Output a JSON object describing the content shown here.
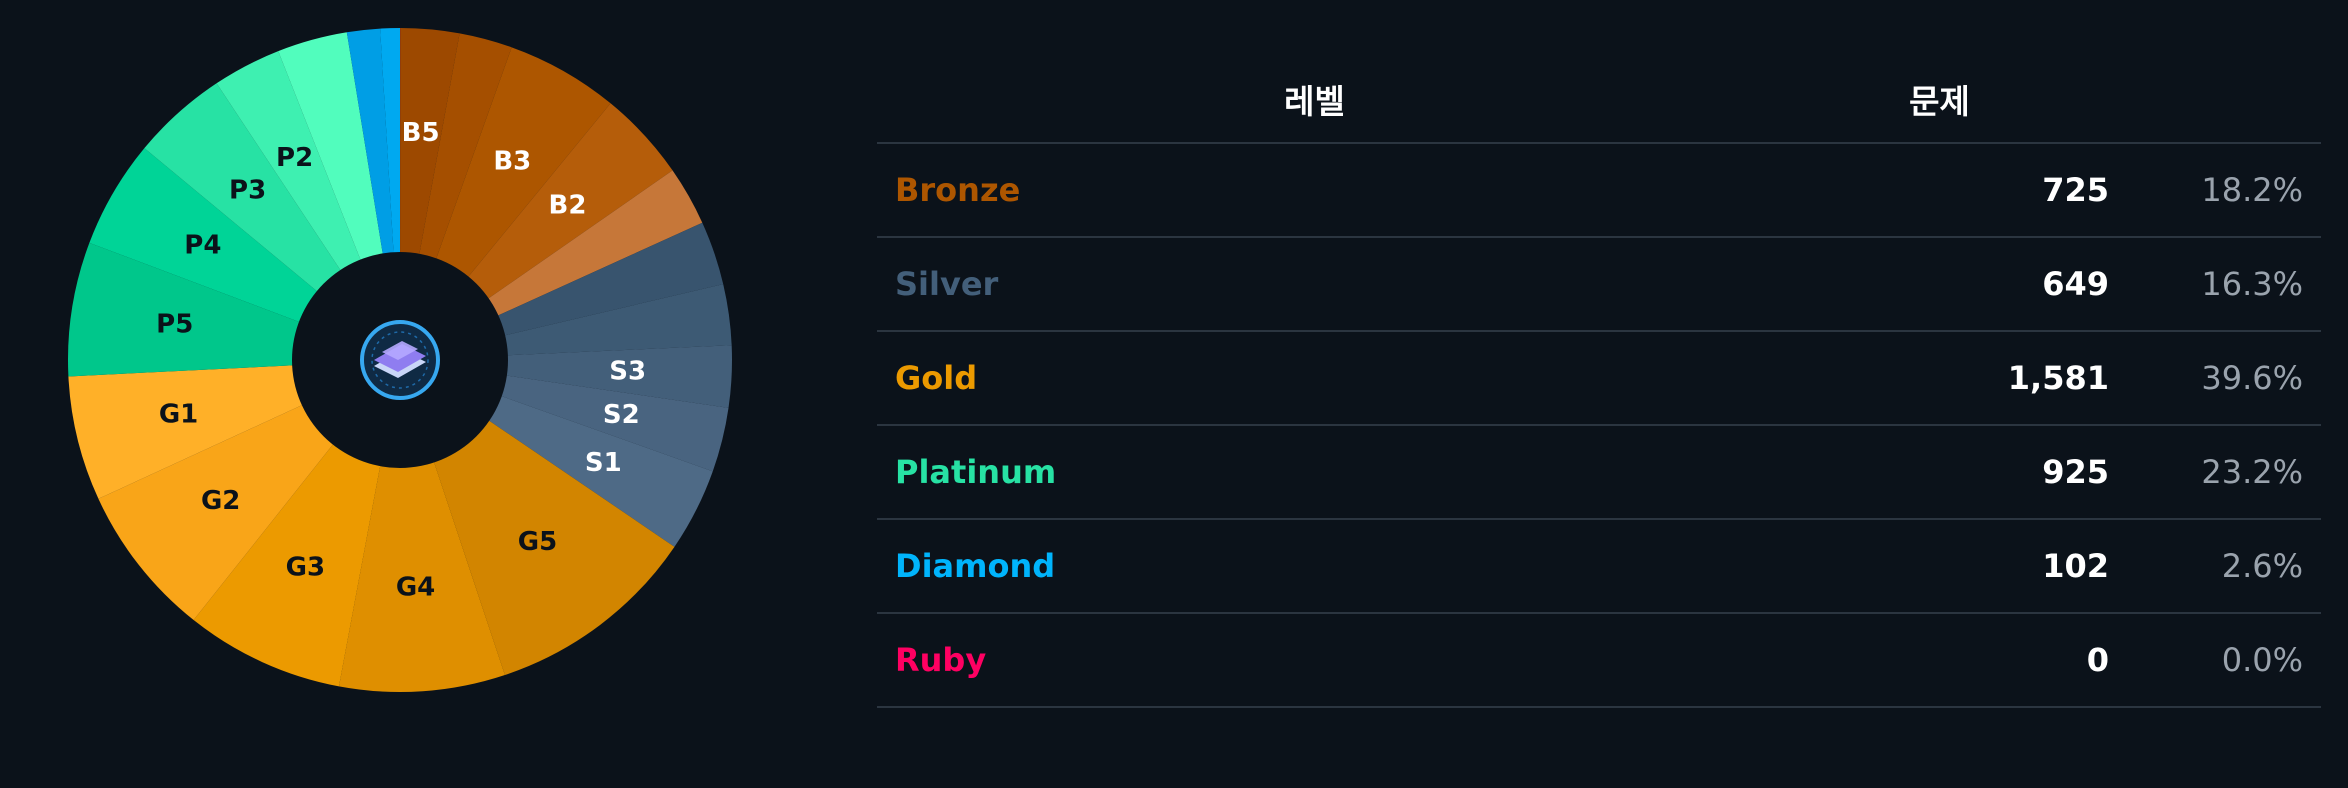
{
  "table": {
    "header_level": "레벨",
    "header_count": "문제",
    "rows": [
      {
        "name": "Bronze",
        "count": "725",
        "percent": "18.2%",
        "color": "#ad5600"
      },
      {
        "name": "Silver",
        "count": "649",
        "percent": "16.3%",
        "color": "#435f7a"
      },
      {
        "name": "Gold",
        "count": "1,581",
        "percent": "39.6%",
        "color": "#ec9a00"
      },
      {
        "name": "Platinum",
        "count": "925",
        "percent": "23.2%",
        "color": "#27e2a4"
      },
      {
        "name": "Diamond",
        "count": "102",
        "percent": "2.6%",
        "color": "#00b4fc"
      },
      {
        "name": "Ruby",
        "count": "0",
        "percent": "0.0%",
        "color": "#ff0062"
      }
    ]
  },
  "chart_data": {
    "type": "pie",
    "donut": true,
    "start": "top, clockwise",
    "slices": [
      {
        "label": "",
        "value": 0.4,
        "color": "#ff0062"
      },
      {
        "label": "B5",
        "value": 114,
        "color": "#9d4900"
      },
      {
        "label": "",
        "value": 103,
        "color": "#a54f00"
      },
      {
        "label": "B3",
        "value": 218,
        "color": "#ad5600"
      },
      {
        "label": "B2",
        "value": 175,
        "color": "#b55d0a"
      },
      {
        "label": "",
        "value": 115,
        "color": "#c67739"
      },
      {
        "label": "",
        "value": 124,
        "color": "#38546e"
      },
      {
        "label": "",
        "value": 118,
        "color": "#3d5a74"
      },
      {
        "label": "S3",
        "value": 120,
        "color": "#435f7a"
      },
      {
        "label": "S2",
        "value": 125,
        "color": "#496480"
      },
      {
        "label": "S1",
        "value": 162,
        "color": "#4e6a86"
      },
      {
        "label": "G5",
        "value": 413,
        "color": "#d28500"
      },
      {
        "label": "G4",
        "value": 321,
        "color": "#df8f00"
      },
      {
        "label": "G3",
        "value": 308,
        "color": "#ec9a00"
      },
      {
        "label": "G2",
        "value": 297,
        "color": "#f9a518"
      },
      {
        "label": "G1",
        "value": 242,
        "color": "#ffb028"
      },
      {
        "label": "P5",
        "value": 260,
        "color": "#00c78b"
      },
      {
        "label": "P4",
        "value": 210,
        "color": "#00d497"
      },
      {
        "label": "P3",
        "value": 186,
        "color": "#27e2a4"
      },
      {
        "label": "P2",
        "value": 133,
        "color": "#3ef0b1"
      },
      {
        "label": "",
        "value": 136,
        "color": "#51fdbd"
      },
      {
        "label": "",
        "value": 64,
        "color": "#009ee5"
      },
      {
        "label": "",
        "value": 38,
        "color": "#00a9f0"
      }
    ],
    "label_colors": {
      "bronze_silver": "#ffffff",
      "gold_platinum": "#0b121a"
    },
    "center_icon": "level-badge-icon"
  }
}
